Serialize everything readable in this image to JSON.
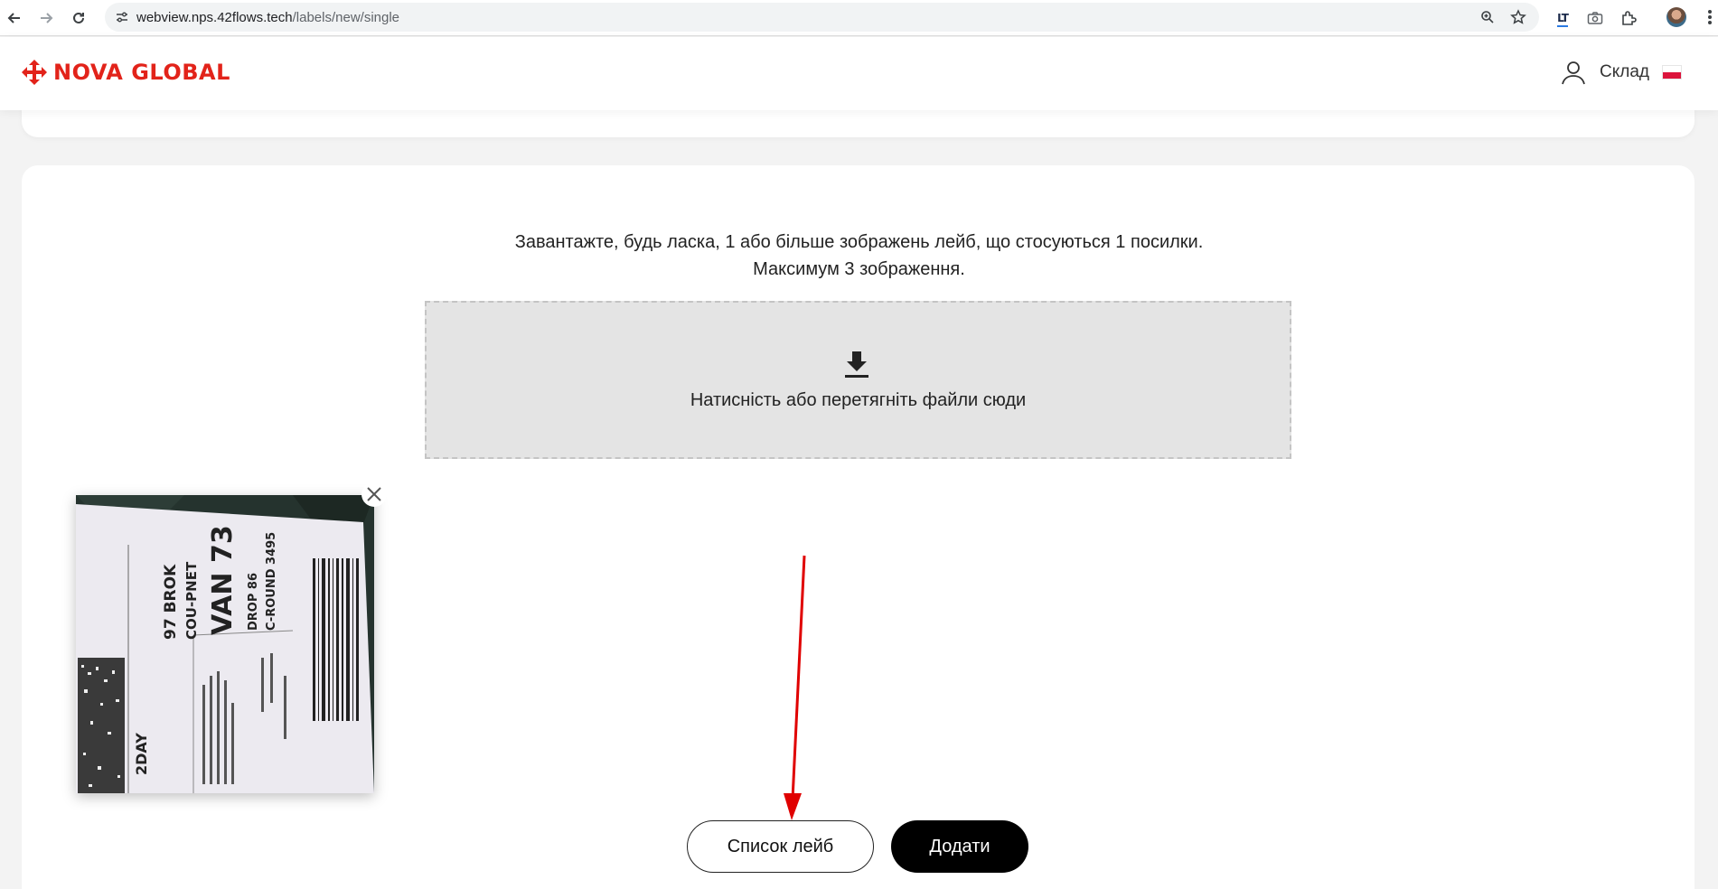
{
  "browser": {
    "url_domain": "webview.nps.42flows.tech",
    "url_path": "/labels/new/single",
    "extension_label": "LT"
  },
  "header": {
    "logo_text": "NOVA GLOBAL",
    "user_label": "Склад",
    "flag_country": "Poland"
  },
  "upload": {
    "instruction_line1": "Завантажте, будь ласка, 1 або більше зображень лейб, що стосуються 1 посилки.",
    "instruction_line2": "Максимум 3 зображення.",
    "dropzone_text": "Натисність або перетягніть файли сюди"
  },
  "thumbnail": {
    "label_lines": [
      "97 BROK",
      "COU-PNET",
      "VAN 73",
      "DROP 86",
      "C-ROUND 3495",
      "2DAY"
    ]
  },
  "actions": {
    "list_button": "Список лейб",
    "add_button": "Додати"
  },
  "colors": {
    "brand_red": "#e2231a",
    "annotation_red": "#e00000"
  }
}
